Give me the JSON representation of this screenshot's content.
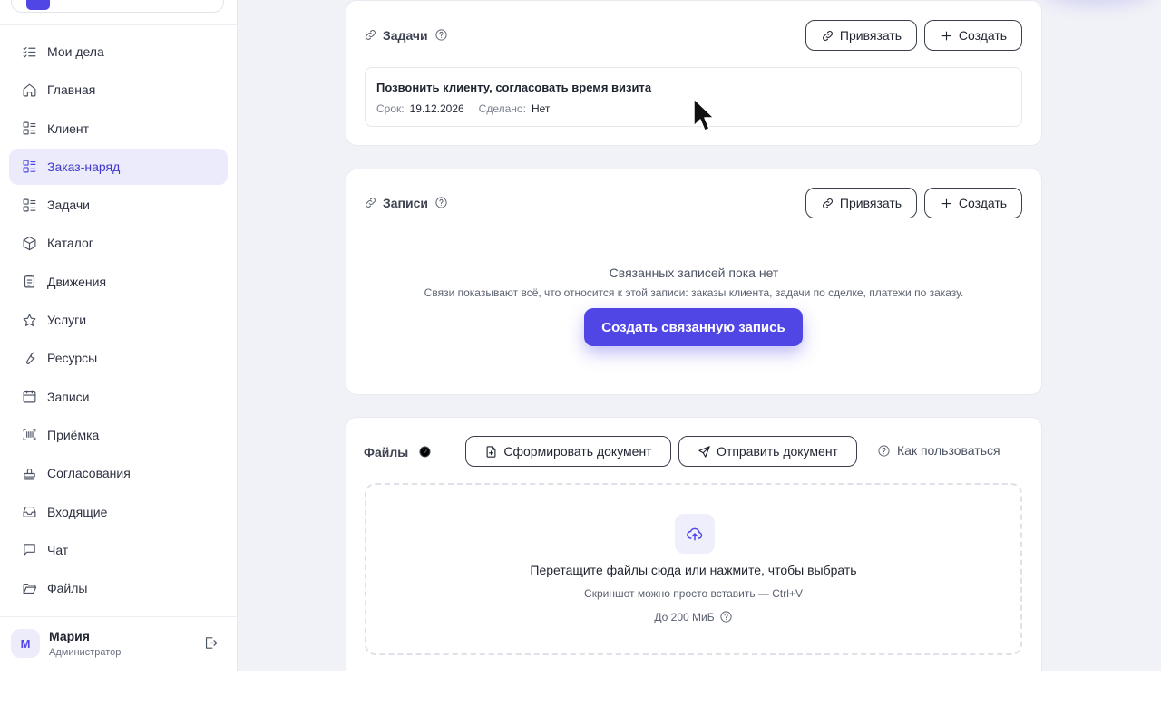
{
  "colors": {
    "accent": "#4f46e5",
    "active_bg": "#ebebfb",
    "page_bg": "#f1f2f7"
  },
  "sidebar": {
    "items": [
      {
        "label": "Мои дела",
        "icon": "list-check-icon",
        "active": false
      },
      {
        "label": "Главная",
        "icon": "home-icon",
        "active": false
      },
      {
        "label": "Клиент",
        "icon": "list-icon",
        "active": false
      },
      {
        "label": "Заказ-наряд",
        "icon": "list-icon",
        "active": true
      },
      {
        "label": "Задачи",
        "icon": "list-icon",
        "active": false
      },
      {
        "label": "Каталог",
        "icon": "box-icon",
        "active": false
      },
      {
        "label": "Движения",
        "icon": "clipboard-icon",
        "active": false
      },
      {
        "label": "Услуги",
        "icon": "star-icon",
        "active": false
      },
      {
        "label": "Ресурсы",
        "icon": "wrench-icon",
        "active": false
      },
      {
        "label": "Записи",
        "icon": "calendar-icon",
        "active": false
      },
      {
        "label": "Приёмка",
        "icon": "scan-icon",
        "active": false
      },
      {
        "label": "Согласования",
        "icon": "stamp-icon",
        "active": false
      },
      {
        "label": "Входящие",
        "icon": "inbox-icon",
        "active": false
      },
      {
        "label": "Чат",
        "icon": "chat-icon",
        "active": false
      },
      {
        "label": "Файлы",
        "icon": "folder-icon",
        "active": false
      }
    ],
    "user": {
      "initial": "М",
      "name": "Мария",
      "role": "Администратор"
    }
  },
  "tasks_card": {
    "title": "Задачи",
    "link_label": "Привязать",
    "create_label": "Создать",
    "task": {
      "title": "Позвонить клиенту, согласовать время визита",
      "due_label": "Срок:",
      "due_value": "19.12.2026",
      "done_label": "Сделано:",
      "done_value": "Нет"
    }
  },
  "records_card": {
    "title": "Записи",
    "link_label": "Привязать",
    "create_label": "Создать",
    "empty_title": "Связанных записей пока нет",
    "empty_sub": "Связи показывают всё, что относится к этой записи: заказы клиента, задачи по сделке, платежи по заказу.",
    "primary_label": "Создать связанную запись"
  },
  "files_card": {
    "title": "Файлы",
    "generate_label": "Сформировать документ",
    "send_label": "Отправить документ",
    "help_label": "Как пользоваться",
    "drop_title": "Перетащите файлы сюда или нажмите, чтобы выбрать",
    "drop_sub": "Скриншот можно просто вставить — Ctrl+V",
    "drop_limit": "До 200 МиБ"
  }
}
